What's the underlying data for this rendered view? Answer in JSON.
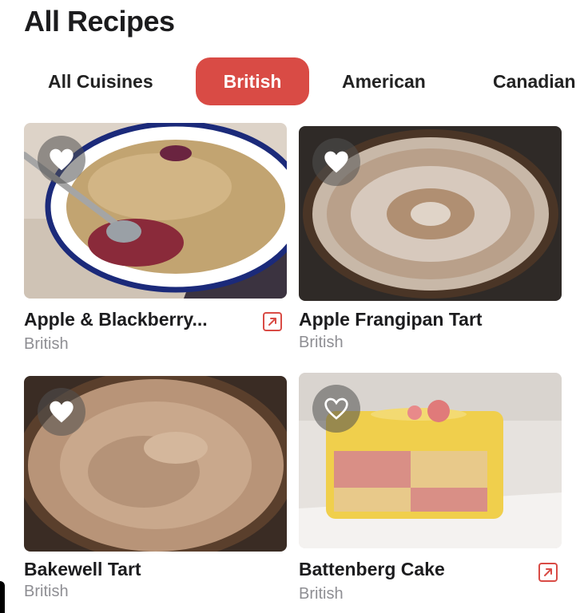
{
  "header": {
    "title": "All Recipes"
  },
  "tabs": [
    {
      "label": "All Cuisines",
      "active": false
    },
    {
      "label": "British",
      "active": true
    },
    {
      "label": "American",
      "active": false
    },
    {
      "label": "Canadian",
      "active": false
    }
  ],
  "recipes": [
    {
      "title": "Apple & Blackberry...",
      "cuisine": "British",
      "favorited": true,
      "has_link": true
    },
    {
      "title": "Apple Frangipan Tart",
      "cuisine": "British",
      "favorited": true,
      "has_link": false
    },
    {
      "title": "Bakewell Tart",
      "cuisine": "British",
      "favorited": true,
      "has_link": false
    },
    {
      "title": "Battenberg Cake",
      "cuisine": "British",
      "favorited": false,
      "has_link": true
    }
  ],
  "icons": {
    "favorite": "heart-icon",
    "link": "external-link-icon"
  },
  "colors": {
    "accent": "#d94b45",
    "text": "#1c1c1e",
    "secondary": "#8e8e93"
  }
}
